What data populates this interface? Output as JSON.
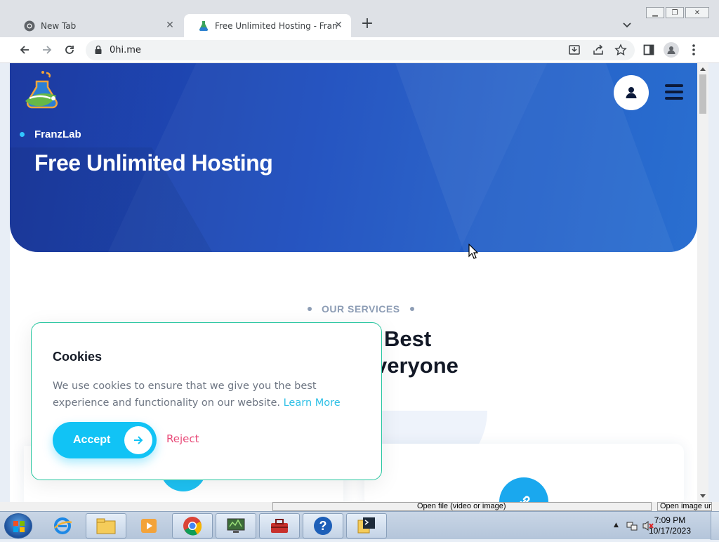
{
  "browser": {
    "tabs": [
      {
        "title": "New Tab",
        "close": "✕"
      },
      {
        "title": "Free Unlimited Hosting - FranzLab",
        "close": "✕"
      }
    ],
    "new_tab": "+",
    "url": "0hi.me",
    "window_buttons": [
      "minimize",
      "restore",
      "close"
    ],
    "icons": [
      "back-icon",
      "forward-icon",
      "reload-icon",
      "lock-icon",
      "download-icon",
      "share-icon",
      "star-icon",
      "side-panel-icon",
      "profile-icon",
      "menu-dots-icon"
    ]
  },
  "page": {
    "brand": "FranzLab",
    "hero_title": "Free Unlimited Hosting",
    "services_label": "OUR SERVICES",
    "headline_line1": "Best",
    "headline_line2": "veryone",
    "colors": {
      "hero": "#1e4fbf",
      "accent": "#11c3f5",
      "reject": "#e84a78",
      "cookie_border": "#28c6a0"
    }
  },
  "cookie": {
    "title": "Cookies",
    "body": "We use cookies to ensure that we give you the best experience and functionality on our website.",
    "learn_more": "Learn More",
    "accept": "Accept",
    "reject": "Reject"
  },
  "status_bar": {
    "left": "Open file (video or image)",
    "right": "Open image url"
  },
  "taskbar": {
    "apps": [
      "internet-explorer-icon",
      "file-explorer-icon",
      "media-player-icon",
      "chrome-icon",
      "monitor-app-icon",
      "toolbox-icon",
      "help-icon",
      "terminal-app-icon"
    ],
    "time": "7:09 PM",
    "date": "10/17/2023"
  }
}
